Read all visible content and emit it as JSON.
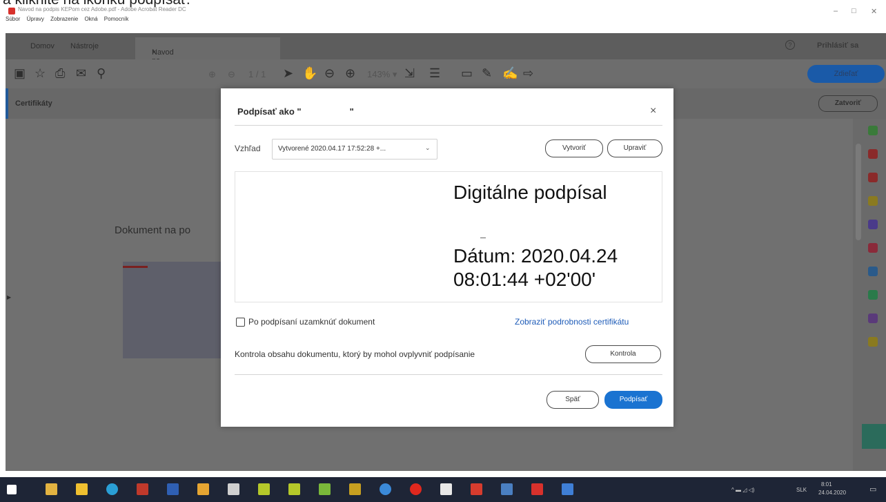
{
  "caption": "a kliknite na ikonku podpísať.",
  "window": {
    "title": "Navod na podpis KEPom cez Adobe.pdf - Adobe Acrobat Reader DC",
    "menu": [
      "Súbor",
      "Úpravy",
      "Zobrazenie",
      "Okná",
      "Pomocník"
    ],
    "controls": [
      "–",
      "□",
      "✕"
    ]
  },
  "tabs": {
    "home": "Domov",
    "tools": "Nástroje",
    "doc": "Navod na podpis K...",
    "doc_close": "×",
    "signin": "Prihlásiť sa"
  },
  "toolbar": {
    "page": "1 / 1",
    "zoom": "143% ▾",
    "share": "Zdieľať"
  },
  "certbar": {
    "label": "Certifikáty",
    "close": "Zatvoriť"
  },
  "document": {
    "text": "Dokument na po"
  },
  "dialog": {
    "title": "Podpísať ako \"",
    "title_end": "\"",
    "close": "×",
    "view_label": "Vzhľad",
    "view_value": "Vytvorené 2020.04.17 17:52:28 +...",
    "create": "Vytvoriť",
    "edit": "Upraviť",
    "sig_line1": "Digitálne podpísal",
    "sig_line2": "Dátum: 2020.04.24",
    "sig_line3": "08:01:44 +02'00'",
    "lock_label": "Po podpísaní uzamknúť dokument",
    "cert_link": "Zobraziť podrobnosti certifikátu",
    "check_text": "Kontrola obsahu dokumentu, ktorý by mohol ovplyvniť podpísanie",
    "check_button": "Kontrola",
    "back": "Späť",
    "sign": "Podpísať"
  },
  "taskbar": {
    "lang": "SLK",
    "time": "8:01",
    "date": "24.04.2020"
  },
  "colors": {
    "accent": "#1a73d1",
    "link": "#1d5bb8",
    "overlay": "#707070",
    "taskbar": "#1e2536"
  }
}
